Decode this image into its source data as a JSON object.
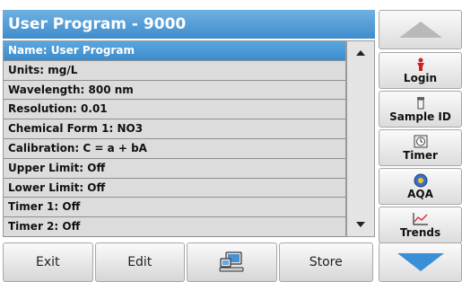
{
  "title": "User Program - 9000",
  "list": {
    "rows": [
      "Name: User Program",
      "Units: mg/L",
      "Wavelength: 800 nm",
      "Resolution: 0.01",
      "Chemical Form 1: NO3",
      "Calibration: C = a + bA",
      "Upper Limit: Off",
      "Lower Limit: Off",
      "Timer 1: Off",
      "Timer 2: Off"
    ],
    "selected_index": 0
  },
  "bottom": {
    "exit": "Exit",
    "edit": "Edit",
    "store": "Store",
    "computer_icon": "computer-icon"
  },
  "side": {
    "login": "Login",
    "sample_id": "Sample ID",
    "timer": "Timer",
    "aqa": "AQA",
    "trends": "Trends"
  },
  "colors": {
    "accent": "#3c8ccd",
    "nav_down": "#3a8fd6",
    "nav_up": "#b9b9b9"
  }
}
